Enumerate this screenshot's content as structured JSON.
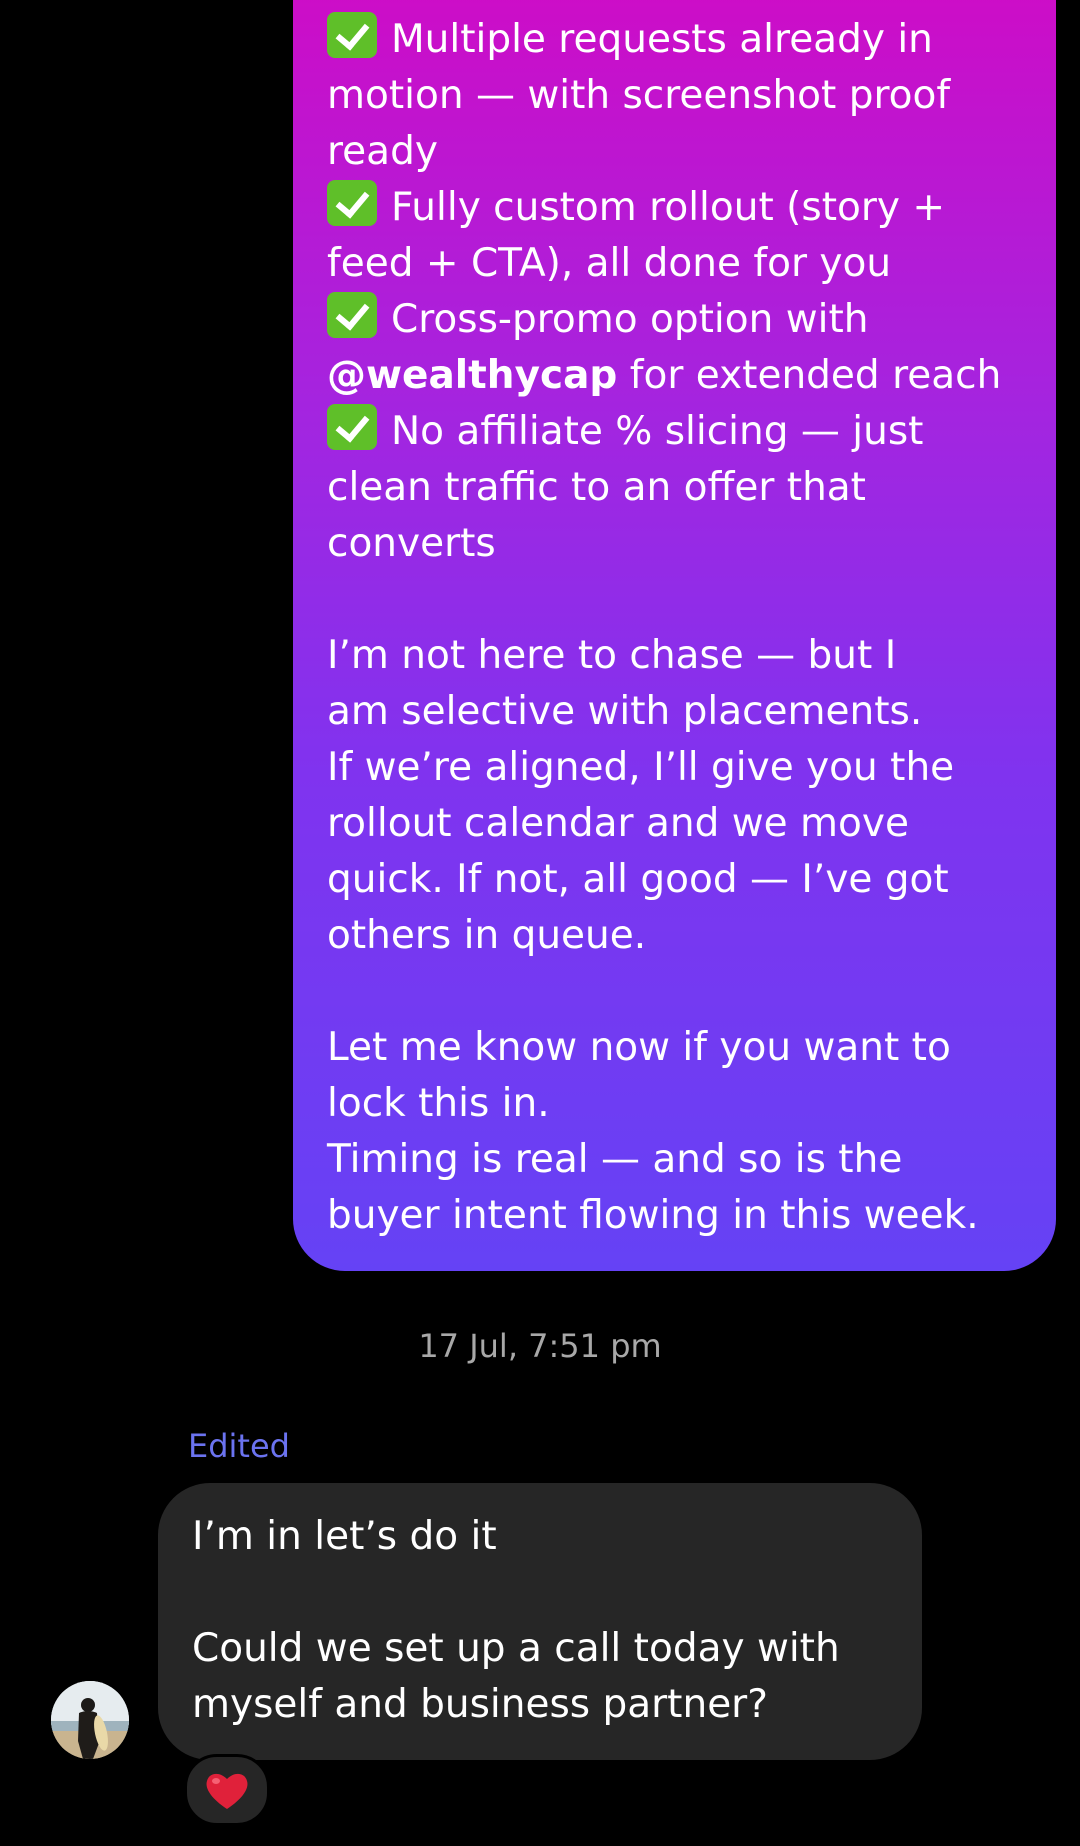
{
  "sent_message": {
    "lines": [
      {
        "check": true,
        "text": "Multiple requests already in"
      },
      {
        "text": "motion — with screenshot proof"
      },
      {
        "text": "ready"
      },
      {
        "check": true,
        "text": "Fully custom rollout (story +"
      },
      {
        "text": "feed + CTA), all done for you"
      },
      {
        "check": true,
        "text": "Cross-promo option with"
      },
      {
        "mention": "@wealthycap",
        "text": " for extended reach"
      },
      {
        "check": true,
        "text": "No affiliate % slicing — just"
      },
      {
        "text": "clean traffic to an offer that"
      },
      {
        "text": "converts"
      },
      {
        "blank": true
      },
      {
        "text": "I’m not here to chase — but I"
      },
      {
        "text": "am selective with placements."
      },
      {
        "text": "If we’re aligned, I’ll give you the"
      },
      {
        "text": "rollout calendar and we move"
      },
      {
        "text": "quick. If not, all good — I’ve got"
      },
      {
        "text": "others in queue."
      },
      {
        "blank": true
      },
      {
        "text": "Let me know now if you want to"
      },
      {
        "text": "lock this in."
      },
      {
        "text": "Timing is real — and so is the"
      },
      {
        "text": "buyer intent flowing in this week."
      }
    ],
    "gradient_colors": [
      "#d00bc5",
      "#6542f5"
    ]
  },
  "timestamp": "17 Jul, 7:51 pm",
  "received_message": {
    "edited_label": "Edited",
    "line1": "I’m in let’s do it",
    "line2": "Could we set up a call today with",
    "line3": "myself and business partner?",
    "reaction": "heart-emoji"
  },
  "colors": {
    "background": "#000000",
    "received_bubble": "#262626",
    "edited": "#6b73f0",
    "timestamp": "#a8a8a8",
    "check_emoji": "#5fbf29",
    "heart": "#e0213a"
  }
}
